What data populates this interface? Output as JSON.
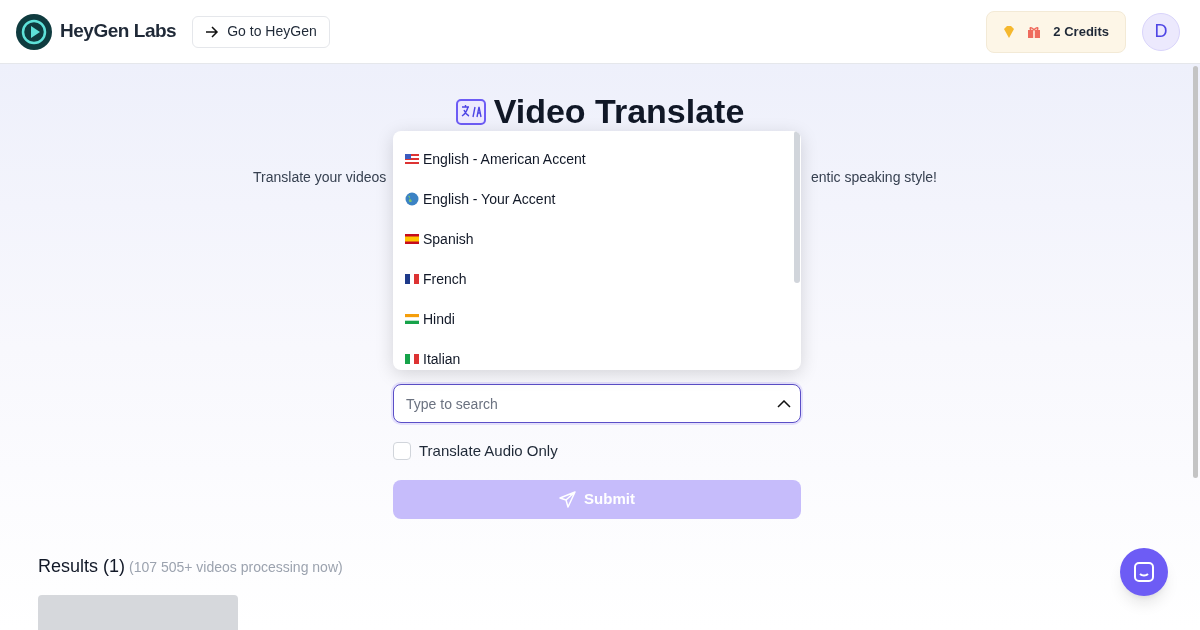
{
  "header": {
    "brand": "HeyGen Labs",
    "nav_button": "Go to HeyGen",
    "credits": "2 Credits",
    "avatar": "D"
  },
  "hero": {
    "title": "Video Translate",
    "subtitle_left": "Translate your videos",
    "subtitle_right": "entic speaking style!"
  },
  "language_menu": {
    "options": [
      {
        "label": "English - American Accent",
        "kind": "us"
      },
      {
        "label": "English - Your Accent",
        "kind": "globe"
      },
      {
        "label": "Spanish",
        "kind": "es"
      },
      {
        "label": "French",
        "kind": "fr"
      },
      {
        "label": "Hindi",
        "kind": "in"
      },
      {
        "label": "Italian",
        "kind": "it"
      }
    ]
  },
  "search": {
    "placeholder": "Type to search",
    "expanded": true
  },
  "audio_only": {
    "label": "Translate Audio Only",
    "checked": false
  },
  "submit": {
    "label": "Submit",
    "disabled": true
  },
  "results": {
    "title": "Results (1)",
    "note": "(107 505+ videos processing now)"
  }
}
